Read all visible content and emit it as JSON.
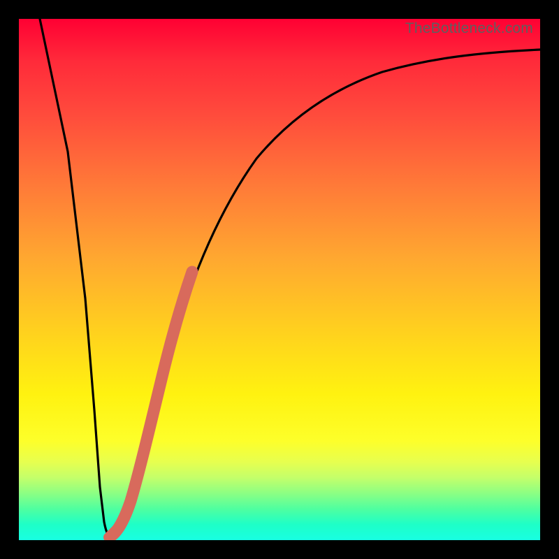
{
  "watermark": "TheBottleneck.com",
  "chart_data": {
    "type": "line",
    "title": "",
    "xlabel": "",
    "ylabel": "",
    "xlim": [
      0,
      100
    ],
    "ylim": [
      0,
      100
    ],
    "series": [
      {
        "name": "bottleneck-curve",
        "x": [
          4,
          6,
          8,
          10,
          12,
          13,
          14,
          15,
          16,
          18,
          20,
          22,
          25,
          30,
          35,
          40,
          45,
          50,
          55,
          60,
          65,
          70,
          75,
          80,
          85,
          90,
          95,
          100
        ],
        "values": [
          100,
          84,
          67,
          50,
          32,
          20,
          8,
          2,
          1,
          6,
          18,
          30,
          42,
          56,
          65,
          72,
          77,
          81,
          84,
          86,
          88,
          89.5,
          90.7,
          91.6,
          92.3,
          92.9,
          93.4,
          93.8
        ]
      },
      {
        "name": "highlight-segment",
        "x": [
          15,
          16,
          17,
          18,
          19,
          20,
          21,
          22,
          23,
          24,
          25,
          26,
          27,
          28,
          29,
          30,
          31
        ],
        "values": [
          2,
          1,
          3,
          6,
          12,
          18,
          24,
          30,
          35,
          39,
          42,
          46,
          49,
          52,
          54,
          56,
          58
        ]
      }
    ]
  }
}
